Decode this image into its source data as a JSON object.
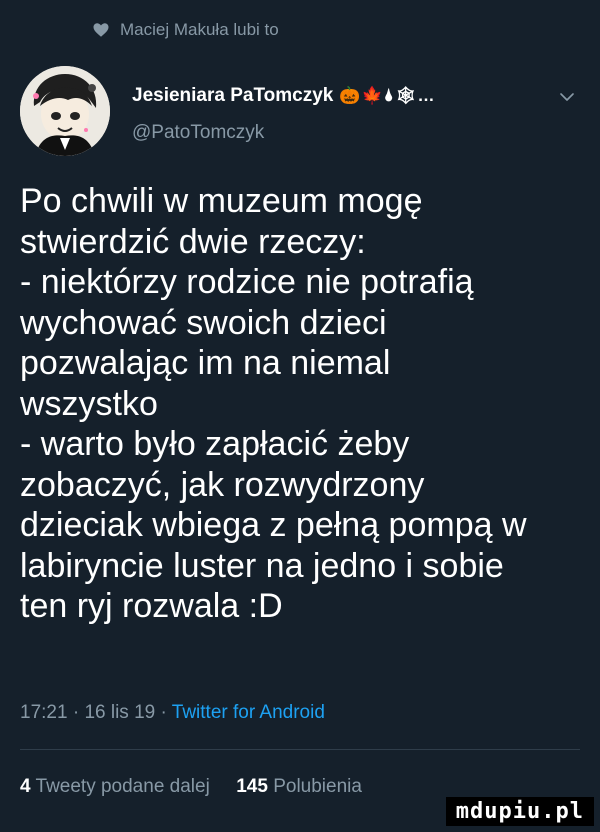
{
  "social_context": {
    "icon": "heart-icon",
    "text": "Maciej Makuła lubi to"
  },
  "author": {
    "display_name": "Jesieniara PaTomczyk",
    "name_emojis": "🎃🍁🌢🕸…",
    "handle": "@PatoTomczyk",
    "avatar": "anime-avatar"
  },
  "tweet": {
    "text": "Po chwili w muzeum mogę\nstwierdzić dwie rzeczy:\n- niektórzy rodzice nie potrafią\nwychować swoich dzieci\npozwalając im na niemal\nwszystko\n- warto było zapłacić żeby\nzobaczyć, jak rozwydrzony\ndzieciak wbiega z pełną pompą w\nlabiryncie luster na jedno i sobie\nten ryj rozwala :D"
  },
  "meta": {
    "time": "17:21",
    "date": "16 lis 19",
    "source": "Twitter for Android"
  },
  "stats": {
    "retweets_count": "4",
    "retweets_label": "Tweety podane dalej",
    "likes_count": "145",
    "likes_label": "Polubienia"
  },
  "watermark": "mdupiu.pl",
  "colors": {
    "background": "#15202b",
    "secondary_text": "#8899a6",
    "link": "#1da1f2"
  }
}
